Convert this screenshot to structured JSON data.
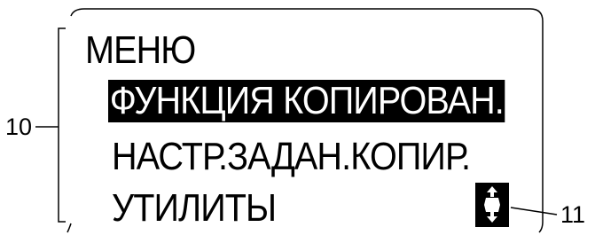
{
  "menu": {
    "title": "МЕНЮ",
    "items": [
      {
        "label": "ФУНКЦИЯ КОПИРОВАН.",
        "selected": true
      },
      {
        "label": "НАСТР.ЗАДАН.КОПИР.",
        "selected": false
      },
      {
        "label": "УТИЛИТЫ",
        "selected": false
      }
    ]
  },
  "callouts": {
    "display_area": "10",
    "scroll_indicator": "11"
  },
  "scroll_indicator": {
    "icon": "up-down-scroll-icon"
  },
  "colors": {
    "highlight_bg": "#000000",
    "highlight_text": "#ffffff",
    "text": "#000000"
  }
}
